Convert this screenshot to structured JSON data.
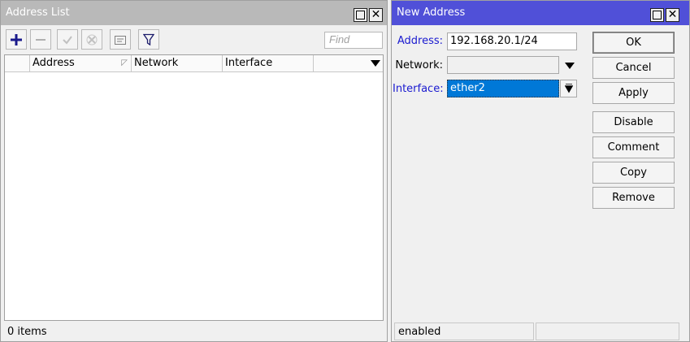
{
  "address_list": {
    "title": "Address List",
    "toolbar": {
      "add_icon": "plus-icon",
      "remove_icon": "minus-icon",
      "enable_icon": "check-icon",
      "disable_icon": "cross-icon",
      "comment_icon": "note-icon",
      "filter_icon": "filter-icon"
    },
    "find_placeholder": "Find",
    "columns": [
      "Address",
      "Network",
      "Interface"
    ],
    "rows": [],
    "status": "0 items"
  },
  "new_address": {
    "title": "New Address",
    "fields": {
      "address_label": "Address:",
      "address_value": "192.168.20.1/24",
      "network_label": "Network:",
      "network_value": "",
      "interface_label": "Interface:",
      "interface_value": "ether2"
    },
    "buttons": {
      "ok": "OK",
      "cancel": "Cancel",
      "apply": "Apply",
      "disable": "Disable",
      "comment": "Comment",
      "copy": "Copy",
      "remove": "Remove"
    },
    "status": "enabled",
    "colors": {
      "title_active": "#5050d8",
      "title_inactive": "#b9b9b9",
      "label_highlight": "#1a1ad0",
      "selection": "#0078d7"
    }
  }
}
